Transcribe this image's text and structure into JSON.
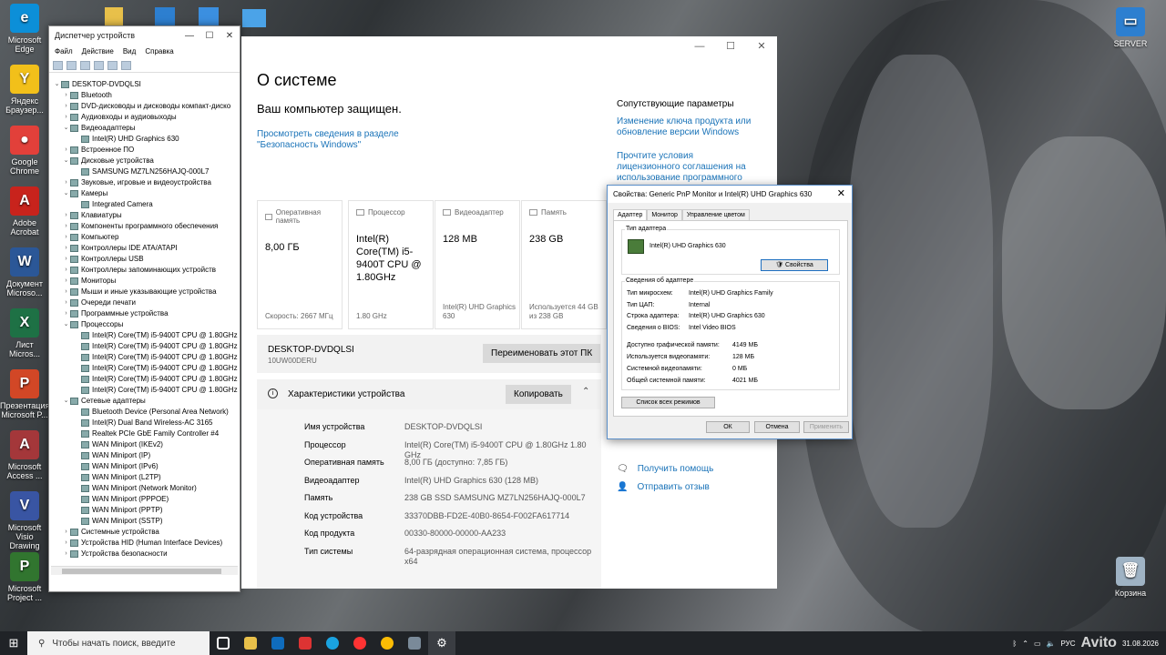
{
  "desktop": {
    "icons": [
      {
        "label": "Microsoft Edge",
        "color": "#0c8fd8",
        "glyph": "e"
      },
      {
        "label": "Яндекс Браузер...",
        "color": "#f2c01a",
        "glyph": "Y"
      },
      {
        "label": "Google Chrome",
        "color": "#e2403a",
        "glyph": "●"
      },
      {
        "label": "Adobe Acrobat",
        "color": "#c8231c",
        "glyph": "A"
      },
      {
        "label": "Документ Microso...",
        "color": "#2b5797",
        "glyph": "W"
      },
      {
        "label": "Лист Micros...",
        "color": "#1e7145",
        "glyph": "X"
      },
      {
        "label": "Презентация Microsoft P...",
        "color": "#d24726",
        "glyph": "P"
      },
      {
        "label": "Microsoft Access ...",
        "color": "#a4373a",
        "glyph": "A"
      },
      {
        "label": "Microsoft Visio Drawing",
        "color": "#3955a3",
        "glyph": "V"
      },
      {
        "label": "Microsoft Project ...",
        "color": "#31752f",
        "glyph": "P"
      }
    ],
    "server_label": "SERVER",
    "recycle_label": "Корзина"
  },
  "devmgr": {
    "title": "Диспетчер устройств",
    "menu": [
      "Файл",
      "Действие",
      "Вид",
      "Справка"
    ],
    "root": "DESKTOP-DVDQLSI",
    "items": [
      {
        "t": "Bluetooth",
        "l": 1,
        "ex": "›"
      },
      {
        "t": "DVD-дисководы и дисководы компакт-диско",
        "l": 1,
        "ex": "›"
      },
      {
        "t": "Аудиовходы и аудиовыходы",
        "l": 1,
        "ex": "›"
      },
      {
        "t": "Видеоадаптеры",
        "l": 1,
        "ex": "⌄"
      },
      {
        "t": "Intel(R) UHD Graphics 630",
        "l": 2,
        "ex": ""
      },
      {
        "t": "Встроенное ПО",
        "l": 1,
        "ex": "›"
      },
      {
        "t": "Дисковые устройства",
        "l": 1,
        "ex": "⌄"
      },
      {
        "t": "SAMSUNG MZ7LN256HAJQ-000L7",
        "l": 2,
        "ex": ""
      },
      {
        "t": "Звуковые, игровые и видеоустройства",
        "l": 1,
        "ex": "›"
      },
      {
        "t": "Камеры",
        "l": 1,
        "ex": "⌄"
      },
      {
        "t": "Integrated Camera",
        "l": 2,
        "ex": ""
      },
      {
        "t": "Клавиатуры",
        "l": 1,
        "ex": "›"
      },
      {
        "t": "Компоненты программного обеспечения",
        "l": 1,
        "ex": "›"
      },
      {
        "t": "Компьютер",
        "l": 1,
        "ex": "›"
      },
      {
        "t": "Контроллеры IDE ATA/ATAPI",
        "l": 1,
        "ex": "›"
      },
      {
        "t": "Контроллеры USB",
        "l": 1,
        "ex": "›"
      },
      {
        "t": "Контроллеры запоминающих устройств",
        "l": 1,
        "ex": "›"
      },
      {
        "t": "Мониторы",
        "l": 1,
        "ex": "›"
      },
      {
        "t": "Мыши и иные указывающие устройства",
        "l": 1,
        "ex": "›"
      },
      {
        "t": "Очереди печати",
        "l": 1,
        "ex": "›"
      },
      {
        "t": "Программные устройства",
        "l": 1,
        "ex": "›"
      },
      {
        "t": "Процессоры",
        "l": 1,
        "ex": "⌄"
      },
      {
        "t": "Intel(R) Core(TM) i5-9400T CPU @ 1.80GHz",
        "l": 2,
        "ex": ""
      },
      {
        "t": "Intel(R) Core(TM) i5-9400T CPU @ 1.80GHz",
        "l": 2,
        "ex": ""
      },
      {
        "t": "Intel(R) Core(TM) i5-9400T CPU @ 1.80GHz",
        "l": 2,
        "ex": ""
      },
      {
        "t": "Intel(R) Core(TM) i5-9400T CPU @ 1.80GHz",
        "l": 2,
        "ex": ""
      },
      {
        "t": "Intel(R) Core(TM) i5-9400T CPU @ 1.80GHz",
        "l": 2,
        "ex": ""
      },
      {
        "t": "Intel(R) Core(TM) i5-9400T CPU @ 1.80GHz",
        "l": 2,
        "ex": ""
      },
      {
        "t": "Сетевые адаптеры",
        "l": 1,
        "ex": "⌄"
      },
      {
        "t": "Bluetooth Device (Personal Area Network)",
        "l": 2,
        "ex": ""
      },
      {
        "t": "Intel(R) Dual Band Wireless-AC 3165",
        "l": 2,
        "ex": ""
      },
      {
        "t": "Realtek PCIe GbE Family Controller #4",
        "l": 2,
        "ex": ""
      },
      {
        "t": "WAN Miniport (IKEv2)",
        "l": 2,
        "ex": ""
      },
      {
        "t": "WAN Miniport (IP)",
        "l": 2,
        "ex": ""
      },
      {
        "t": "WAN Miniport (IPv6)",
        "l": 2,
        "ex": ""
      },
      {
        "t": "WAN Miniport (L2TP)",
        "l": 2,
        "ex": ""
      },
      {
        "t": "WAN Miniport (Network Monitor)",
        "l": 2,
        "ex": ""
      },
      {
        "t": "WAN Miniport (PPPOE)",
        "l": 2,
        "ex": ""
      },
      {
        "t": "WAN Miniport (PPTP)",
        "l": 2,
        "ex": ""
      },
      {
        "t": "WAN Miniport (SSTP)",
        "l": 2,
        "ex": ""
      },
      {
        "t": "Системные устройства",
        "l": 1,
        "ex": "›"
      },
      {
        "t": "Устройства HID (Human Interface Devices)",
        "l": 1,
        "ex": "›"
      },
      {
        "t": "Устройства безопасности",
        "l": 1,
        "ex": "›"
      }
    ]
  },
  "settings": {
    "title": "О системе",
    "protected": "Ваш компьютер защищен.",
    "security_link": "Просмотреть сведения в разделе \"Безопасность Windows\"",
    "related_title": "Сопутствующие параметры",
    "related_links": [
      "Изменение ключа продукта или обновление версии Windows",
      "Прочтите условия лицензионного соглашения на использование программного обеспечения"
    ],
    "cards": [
      {
        "title": "Оперативная память",
        "value": "8,00 ГБ",
        "sub": "Скорость: 2667 МГц"
      },
      {
        "title": "Процессор",
        "value": "Intel(R) Core(TM) i5-9400T CPU @ 1.80GHz",
        "sub": "1.80 GHz"
      },
      {
        "title": "Видеоадаптер",
        "value": "128 MB",
        "sub": "Intel(R) UHD Graphics 630"
      },
      {
        "title": "Память",
        "value": "238 GB",
        "sub": "Используется 44 GB из 238 GB"
      }
    ],
    "pc_name": "DESKTOP-DVDQLSI",
    "pc_sub": "10UW00DERU",
    "rename_btn": "Переименовать этот ПК",
    "specs_title": "Характеристики устройства",
    "copy_btn": "Копировать",
    "specs": [
      {
        "k": "Имя устройства",
        "v": "DESKTOP-DVDQLSI"
      },
      {
        "k": "Процессор",
        "v": "Intel(R) Core(TM) i5-9400T CPU @ 1.80GHz   1.80 GHz"
      },
      {
        "k": "Оперативная память",
        "v": "8,00 ГБ (доступно: 7,85 ГБ)"
      },
      {
        "k": "Видеоадаптер",
        "v": "Intel(R) UHD Graphics 630 (128 MB)"
      },
      {
        "k": "Память",
        "v": "238 GB SSD SAMSUNG MZ7LN256HAJQ-000L7"
      },
      {
        "k": "Код устройства",
        "v": "33370DBB-FD2E-40B0-8654-F002FA617714"
      },
      {
        "k": "Код продукта",
        "v": "00330-80000-00000-AA233"
      },
      {
        "k": "Тип системы",
        "v": "64-разрядная операционная система, процессор x64"
      }
    ],
    "help": "Получить помощь",
    "feedback": "Отправить отзыв"
  },
  "props": {
    "title": "Свойства: Generic PnP Monitor и Intel(R) UHD Graphics 630",
    "tabs": [
      "Адаптер",
      "Монитор",
      "Управление цветом"
    ],
    "adapter_type_label": "Тип адаптера",
    "adapter_name": "Intel(R) UHD Graphics 630",
    "props_btn": "Свойства",
    "info_label": "Сведения об адаптере",
    "info": [
      {
        "k": "Тип микросхем:",
        "v": "Intel(R) UHD Graphics Family"
      },
      {
        "k": "Тип ЦАП:",
        "v": "Internal"
      },
      {
        "k": "Строка адаптера:",
        "v": "Intel(R) UHD Graphics 630"
      },
      {
        "k": "Сведения о BIOS:",
        "v": "Intel Video BIOS"
      }
    ],
    "mem": [
      {
        "k": "Доступно графической памяти:",
        "v": "4149 МБ"
      },
      {
        "k": "Используется видеопамяти:",
        "v": "128 МБ"
      },
      {
        "k": "Системной видеопамяти:",
        "v": "0 МБ"
      },
      {
        "k": "Общей системной памяти:",
        "v": "4021 МБ"
      }
    ],
    "list_btn": "Список всех режимов",
    "ok": "ОК",
    "cancel": "Отмена",
    "apply": "Применить"
  },
  "taskbar": {
    "search_placeholder": "Чтобы начать поиск, введите",
    "lang": "РУС",
    "date": "31.08.2026",
    "watermark": "Avito"
  }
}
